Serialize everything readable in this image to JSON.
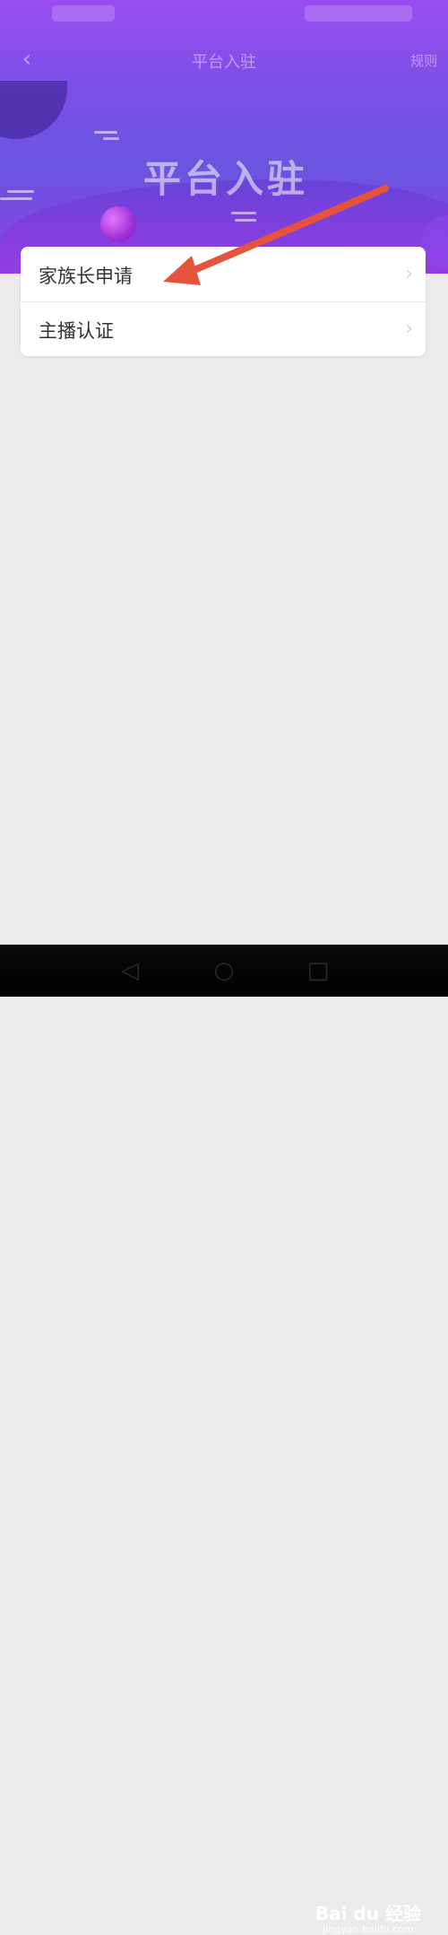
{
  "header": {
    "nav_title": "平台入驻",
    "nav_right": "规则",
    "banner_title": "平台入驻"
  },
  "menu": {
    "items": [
      {
        "label": "家族长申请"
      },
      {
        "label": "主播认证"
      }
    ]
  },
  "annotation": {
    "arrow_color": "#e5533d"
  },
  "watermark": {
    "logo": "Bai du 经验",
    "url": "jingyan.baidu.com"
  },
  "colors": {
    "header_top": "#9a4df0",
    "header_bottom": "#8b3fe2",
    "page_bg": "#ebebeb"
  }
}
